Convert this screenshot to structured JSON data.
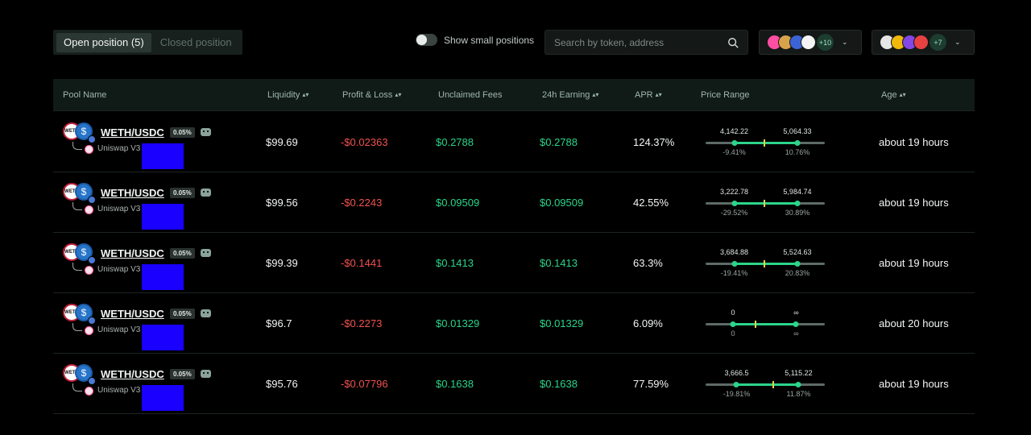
{
  "tabs": {
    "open": "Open position (5)",
    "closed": "Closed position"
  },
  "toggle": {
    "label": "Show small positions",
    "on": false
  },
  "search": {
    "placeholder": "Search by token, address"
  },
  "chain_filters": [
    {
      "more": "+10",
      "chevron": "⌄"
    },
    {
      "more": "+7",
      "chevron": "⌄"
    }
  ],
  "colors": {
    "positive": "#2bd58a",
    "negative": "#f0524f",
    "redaction": "#1900ff"
  },
  "table": {
    "headers": {
      "pool": "Pool Name",
      "liquidity": "Liquidity",
      "pnl": "Profit & Loss",
      "fees": "Unclaimed Fees",
      "earning": "24h Earning",
      "apr": "APR",
      "range": "Price Range",
      "age": "Age"
    },
    "sort_glyph": "▴▾",
    "rows": [
      {
        "pair": "WETH/USDC",
        "fee": "0.05%",
        "dex": "Uniswap V3",
        "liquidity": "$99.69",
        "pnl": "-$0.02363",
        "fees": "$0.2788",
        "earning": "$0.2788",
        "apr": "124.37%",
        "age": "about 19 hours",
        "range": {
          "min": "4,142.22",
          "max": "5,064.33",
          "min_pct": "-9.41%",
          "max_pct": "10.76%",
          "min_pos": 0.24,
          "max_pos": 0.77,
          "current_pos": 0.49
        }
      },
      {
        "pair": "WETH/USDC",
        "fee": "0.05%",
        "dex": "Uniswap V3",
        "liquidity": "$99.56",
        "pnl": "-$0.2243",
        "fees": "$0.09509",
        "earning": "$0.09509",
        "apr": "42.55%",
        "age": "about 19 hours",
        "range": {
          "min": "3,222.78",
          "max": "5,984.74",
          "min_pct": "-29.52%",
          "max_pct": "30.89%",
          "min_pos": 0.24,
          "max_pos": 0.77,
          "current_pos": 0.49
        }
      },
      {
        "pair": "WETH/USDC",
        "fee": "0.05%",
        "dex": "Uniswap V3",
        "liquidity": "$99.39",
        "pnl": "-$0.1441",
        "fees": "$0.1413",
        "earning": "$0.1413",
        "apr": "63.3%",
        "age": "about 19 hours",
        "range": {
          "min": "3,684.88",
          "max": "5,524.63",
          "min_pct": "-19.41%",
          "max_pct": "20.83%",
          "min_pos": 0.24,
          "max_pos": 0.77,
          "current_pos": 0.49
        }
      },
      {
        "pair": "WETH/USDC",
        "fee": "0.05%",
        "dex": "Uniswap V3",
        "liquidity": "$96.7",
        "pnl": "-$0.2273",
        "fees": "$0.01329",
        "earning": "$0.01329",
        "apr": "6.09%",
        "age": "about 20 hours",
        "range": {
          "min": "0",
          "max": "∞",
          "min_pct": "0",
          "max_pct": "∞",
          "min_pos": 0.23,
          "max_pos": 0.76,
          "current_pos": 0.42
        }
      },
      {
        "pair": "WETH/USDC",
        "fee": "0.05%",
        "dex": "Uniswap V3",
        "liquidity": "$95.76",
        "pnl": "-$0.07796",
        "fees": "$0.1638",
        "earning": "$0.1638",
        "apr": "77.59%",
        "age": "about 19 hours",
        "range": {
          "min": "3,666.5",
          "max": "5,115.22",
          "min_pct": "-19.81%",
          "max_pct": "11.87%",
          "min_pos": 0.26,
          "max_pos": 0.78,
          "current_pos": 0.57
        }
      }
    ]
  }
}
